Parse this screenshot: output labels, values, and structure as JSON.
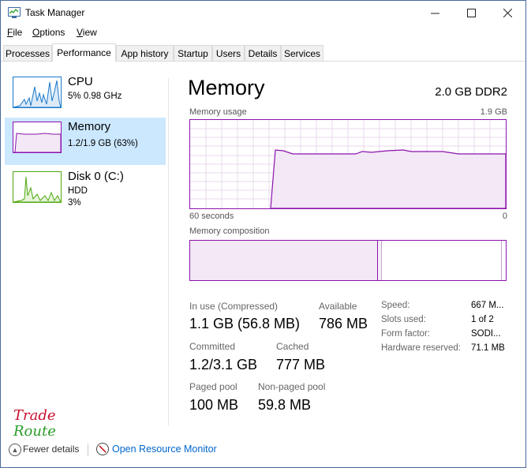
{
  "titlebar": {
    "title": "Task Manager",
    "minimize_icon": "minimize-icon",
    "maximize_icon": "maximize-icon",
    "close_icon": "close-icon"
  },
  "menu": {
    "file": {
      "hot": "F",
      "rest": "ile"
    },
    "options": {
      "hot": "O",
      "rest": "ptions"
    },
    "view": {
      "hot": "V",
      "rest": "iew"
    }
  },
  "tabs": [
    "Processes",
    "Performance",
    "App history",
    "Startup",
    "Users",
    "Details",
    "Services"
  ],
  "active_tab": "Performance",
  "sidebar": [
    {
      "title": "CPU",
      "sub1": "5%  0.98 GHz",
      "sub2": "",
      "color": "#1a77c8"
    },
    {
      "title": "Memory",
      "sub1": "1.2/1.9 GB (63%)",
      "sub2": "",
      "color": "#8b12ae"
    },
    {
      "title": "Disk 0 (C:)",
      "sub1": "HDD",
      "sub2": "3%",
      "color": "#4da80c"
    }
  ],
  "main": {
    "heading": "Memory",
    "spec": "2.0 GB DDR2",
    "usage_label": "Memory usage",
    "usage_max": "1.9 GB",
    "time_left": "60 seconds",
    "time_right": "0",
    "composition_label": "Memory composition"
  },
  "stats": {
    "in_use_label": "In use (Compressed)",
    "in_use_value": "1.1 GB (56.8 MB)",
    "available_label": "Available",
    "available_value": "786 MB",
    "committed_label": "Committed",
    "committed_value": "1.2/3.1 GB",
    "cached_label": "Cached",
    "cached_value": "777 MB",
    "paged_label": "Paged pool",
    "paged_value": "100 MB",
    "nonpaged_label": "Non-paged pool",
    "nonpaged_value": "59.8 MB"
  },
  "details": [
    {
      "label": "Speed:",
      "value": "667 M..."
    },
    {
      "label": "Slots used:",
      "value": "1 of 2"
    },
    {
      "label": "Form factor:",
      "value": "SODI..."
    },
    {
      "label": "Hardware reserved:",
      "value": "71.1 MB"
    }
  ],
  "footer": {
    "fewer_details": "Fewer details",
    "open_monitor": "Open Resource Monitor"
  },
  "watermark": {
    "line1": "Trade",
    "line2": "Route"
  },
  "colors": {
    "memory": "#8b12ae",
    "cpu": "#1a77c8",
    "disk": "#4da80c",
    "selected": "#cce8ff"
  }
}
